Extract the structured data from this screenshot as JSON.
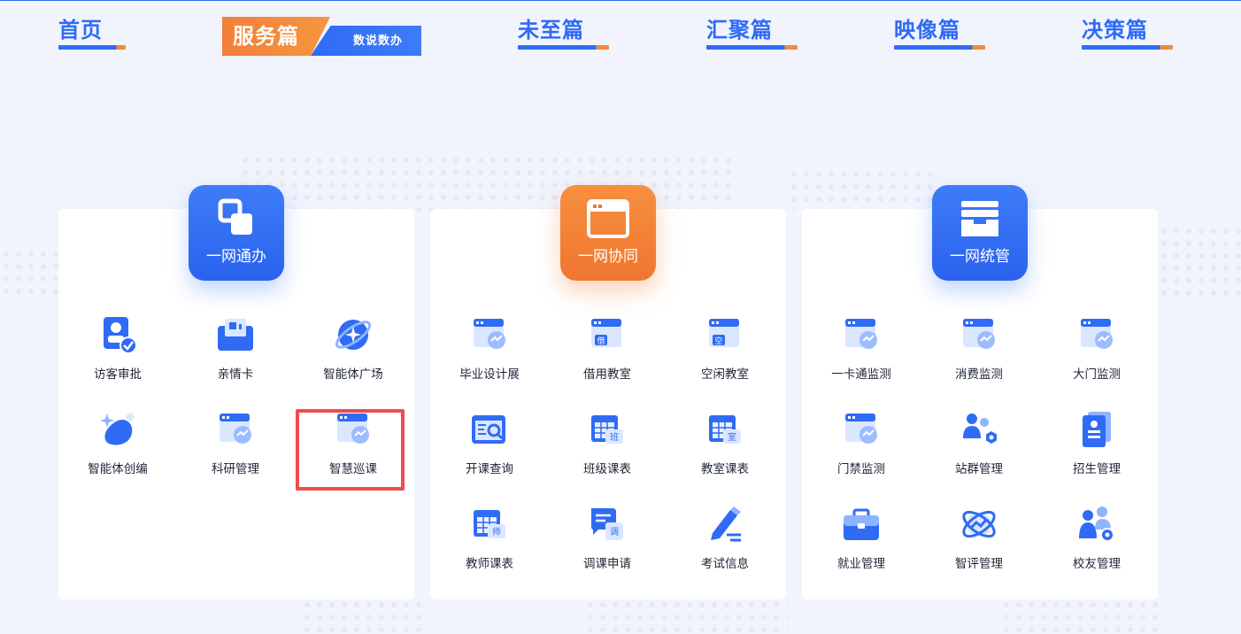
{
  "nav": {
    "items": [
      {
        "label": "首页"
      },
      {
        "label": "未至篇"
      },
      {
        "label": "汇聚篇"
      },
      {
        "label": "映像篇"
      },
      {
        "label": "决策篇"
      }
    ],
    "active": {
      "label": "服务篇",
      "sub_label": "数说数办"
    }
  },
  "colors": {
    "primary": "#2f6bf5",
    "accent": "#f37f3a",
    "highlight": "#f04b4d"
  },
  "cards": [
    {
      "title": "一网通办",
      "badge_icon": "overlap-squares-icon",
      "tiles": [
        {
          "label": "访客审批",
          "icon": "visitor-approval-icon"
        },
        {
          "label": "亲情卡",
          "icon": "family-card-icon"
        },
        {
          "label": "智能体广场",
          "icon": "ai-agent-plaza-icon"
        },
        {
          "label": "智能体创编",
          "icon": "ai-agent-create-icon"
        },
        {
          "label": "科研管理",
          "icon": "research-window-icon"
        },
        {
          "label": "智慧巡课",
          "icon": "patrol-window-icon"
        }
      ]
    },
    {
      "title": "一网协同",
      "badge_icon": "browser-window-icon",
      "tiles": [
        {
          "label": "毕业设计展",
          "icon": "graduation-window-icon"
        },
        {
          "label": "借用教室",
          "icon": "borrow-room-icon",
          "glyph": "借"
        },
        {
          "label": "空闲教室",
          "icon": "free-room-icon",
          "glyph": "空"
        },
        {
          "label": "开课查询",
          "icon": "course-search-icon"
        },
        {
          "label": "班级课表",
          "icon": "class-schedule-icon",
          "glyph": "班"
        },
        {
          "label": "教室课表",
          "icon": "room-schedule-icon",
          "glyph": "室"
        },
        {
          "label": "教师课表",
          "icon": "teacher-schedule-icon",
          "glyph": "师"
        },
        {
          "label": "调课申请",
          "icon": "reschedule-request-icon",
          "glyph": "调"
        },
        {
          "label": "考试信息",
          "icon": "exam-pen-icon"
        }
      ]
    },
    {
      "title": "一网统管",
      "badge_icon": "archive-box-icon",
      "tiles": [
        {
          "label": "一卡通监测",
          "icon": "card-monitor-window-icon"
        },
        {
          "label": "消费监测",
          "icon": "consume-monitor-window-icon"
        },
        {
          "label": "大门监测",
          "icon": "gate-monitor-window-icon"
        },
        {
          "label": "门禁监测",
          "icon": "access-monitor-window-icon"
        },
        {
          "label": "站群管理",
          "icon": "site-group-icon"
        },
        {
          "label": "招生管理",
          "icon": "enrollment-doc-icon"
        },
        {
          "label": "就业管理",
          "icon": "briefcase-icon"
        },
        {
          "label": "智评管理",
          "icon": "smart-evaluation-icon"
        },
        {
          "label": "校友管理",
          "icon": "alumni-group-icon"
        }
      ]
    }
  ]
}
